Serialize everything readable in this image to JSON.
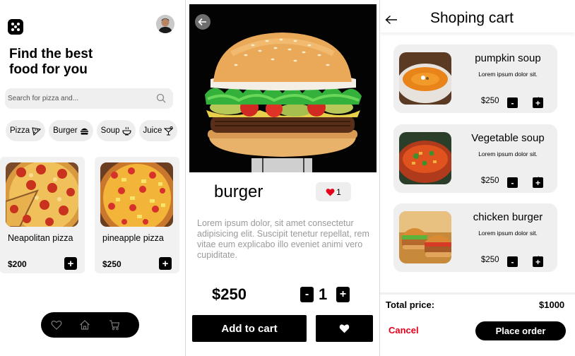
{
  "home": {
    "headline_line1": "Find the best",
    "headline_line2": "food for you",
    "search_placeholder": "Search for pizza and...",
    "categories": [
      {
        "label": "Pizza",
        "icon": "pizza-icon"
      },
      {
        "label": "Burger",
        "icon": "burger-icon"
      },
      {
        "label": "Soup",
        "icon": "soup-icon"
      },
      {
        "label": "Juice",
        "icon": "juice-icon"
      }
    ],
    "products": [
      {
        "name": "Neapolitan pizza",
        "price": "$200"
      },
      {
        "name": "pineapple pizza",
        "price": "$250"
      }
    ],
    "add_symbol": "+",
    "nav": [
      "heart-icon",
      "home-icon",
      "cart-icon"
    ]
  },
  "detail": {
    "title": "burger",
    "likes": "1",
    "description": "Lorem ipsum dolor, sit amet consectetur adipisicing elit. Suscipit tenetur repellat, rem vitae eum explicabo illo eveniet animi vero cupiditate.",
    "price": "$250",
    "quantity": "1",
    "minus": "-",
    "plus": "+",
    "add_to_cart": "Add to cart"
  },
  "cart": {
    "title": "Shoping cart",
    "items": [
      {
        "name": "pumpkin soup",
        "desc": "Lorem ipsum dolor sit.",
        "price": "$250",
        "qty": "1"
      },
      {
        "name": "Vegetable soup",
        "desc": "Lorem ipsum dolor sit.",
        "price": "$250",
        "qty": "1"
      },
      {
        "name": "chicken burger",
        "desc": "Lorem ipsum dolor sit.",
        "price": "$250",
        "qty": "1"
      }
    ],
    "total_label": "Total price:",
    "total_value": "$1000",
    "cancel": "Cancel",
    "place_order": "Place order"
  },
  "colors": {
    "accent": "#000000",
    "cancel": "#e4001b",
    "card_bg": "#efefef",
    "like": "#e4001b"
  }
}
